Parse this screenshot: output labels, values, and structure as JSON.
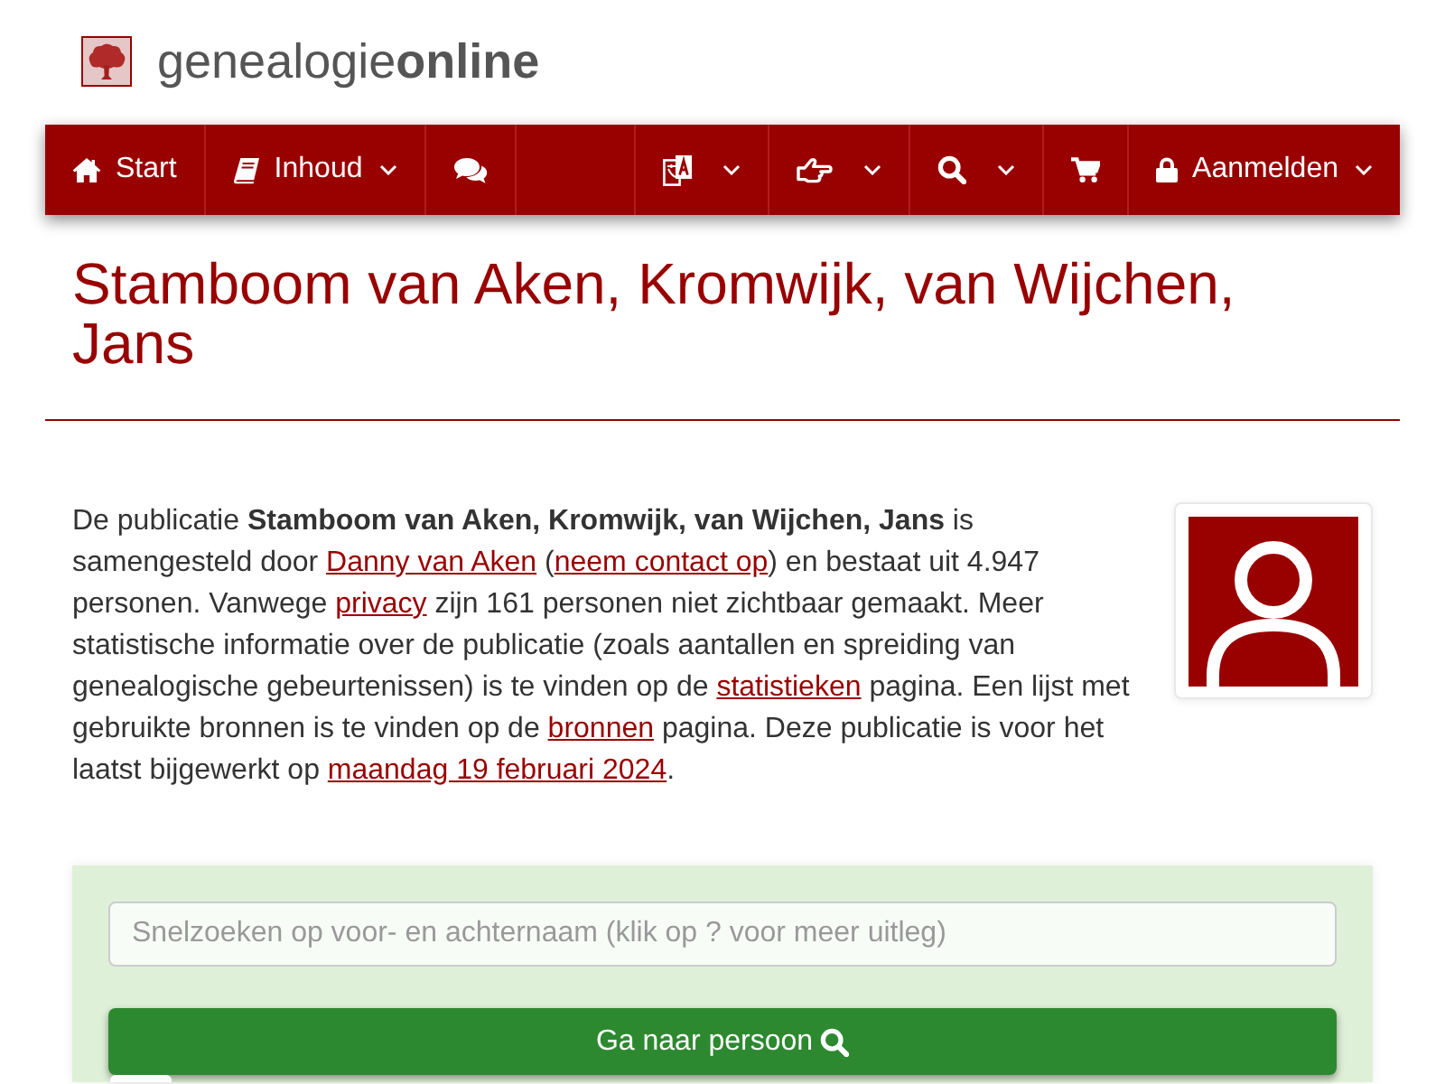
{
  "header": {
    "logo_text": "genealogie**online**"
  },
  "nav": {
    "left": [
      {
        "label": "Start",
        "has_menu": false
      },
      {
        "label": "Inhoud",
        "has_menu": true
      },
      {
        "has_menu": false
      }
    ],
    "right": [
      {
        "has_menu": true
      },
      {
        "has_menu": true
      },
      {
        "has_menu": true
      },
      {
        "has_menu": false
      },
      {
        "label": "Aanmelden",
        "has_menu": true
      }
    ]
  },
  "title": "Stamboom van Aken, Kromwijk, van Wijchen, Jans",
  "intro": [
    {
      "kind": "text",
      "text": "De publicatie **Stamboom van Aken, Kromwijk, van Wijchen, Jans** is samengesteld door "
    },
    {
      "kind": "link",
      "text": "Danny van Aken"
    },
    {
      "kind": "text",
      "text": " ("
    },
    {
      "kind": "link",
      "text": "neem contact op"
    },
    {
      "kind": "text",
      "text": ") en bestaat uit 4.947 personen. Vanwege "
    },
    {
      "kind": "link",
      "text": "privacy"
    },
    {
      "kind": "text",
      "text": " zijn 161 personen niet zichtbaar gemaakt. Meer statistische informatie over de publicatie (zoals aantallen en spreiding van genealogische gebeurtenissen) is te vinden op de "
    },
    {
      "kind": "link",
      "text": "statistieken"
    },
    {
      "kind": "text",
      "text": " pagina. Een lijst met gebruikte bronnen is te vinden op de "
    },
    {
      "kind": "link",
      "text": "bronnen"
    },
    {
      "kind": "text",
      "text": " pagina. Deze publicatie is voor het laatst bijgewerkt op "
    },
    {
      "kind": "link",
      "text": "maandag 19 februari 2024"
    },
    {
      "kind": "text",
      "text": "."
    }
  ],
  "quick_search": {
    "placeholder": "Snelzoeken op voor- en achternaam (klik op ? voor meer uitleg)",
    "button": "Ga naar persoon"
  }
}
